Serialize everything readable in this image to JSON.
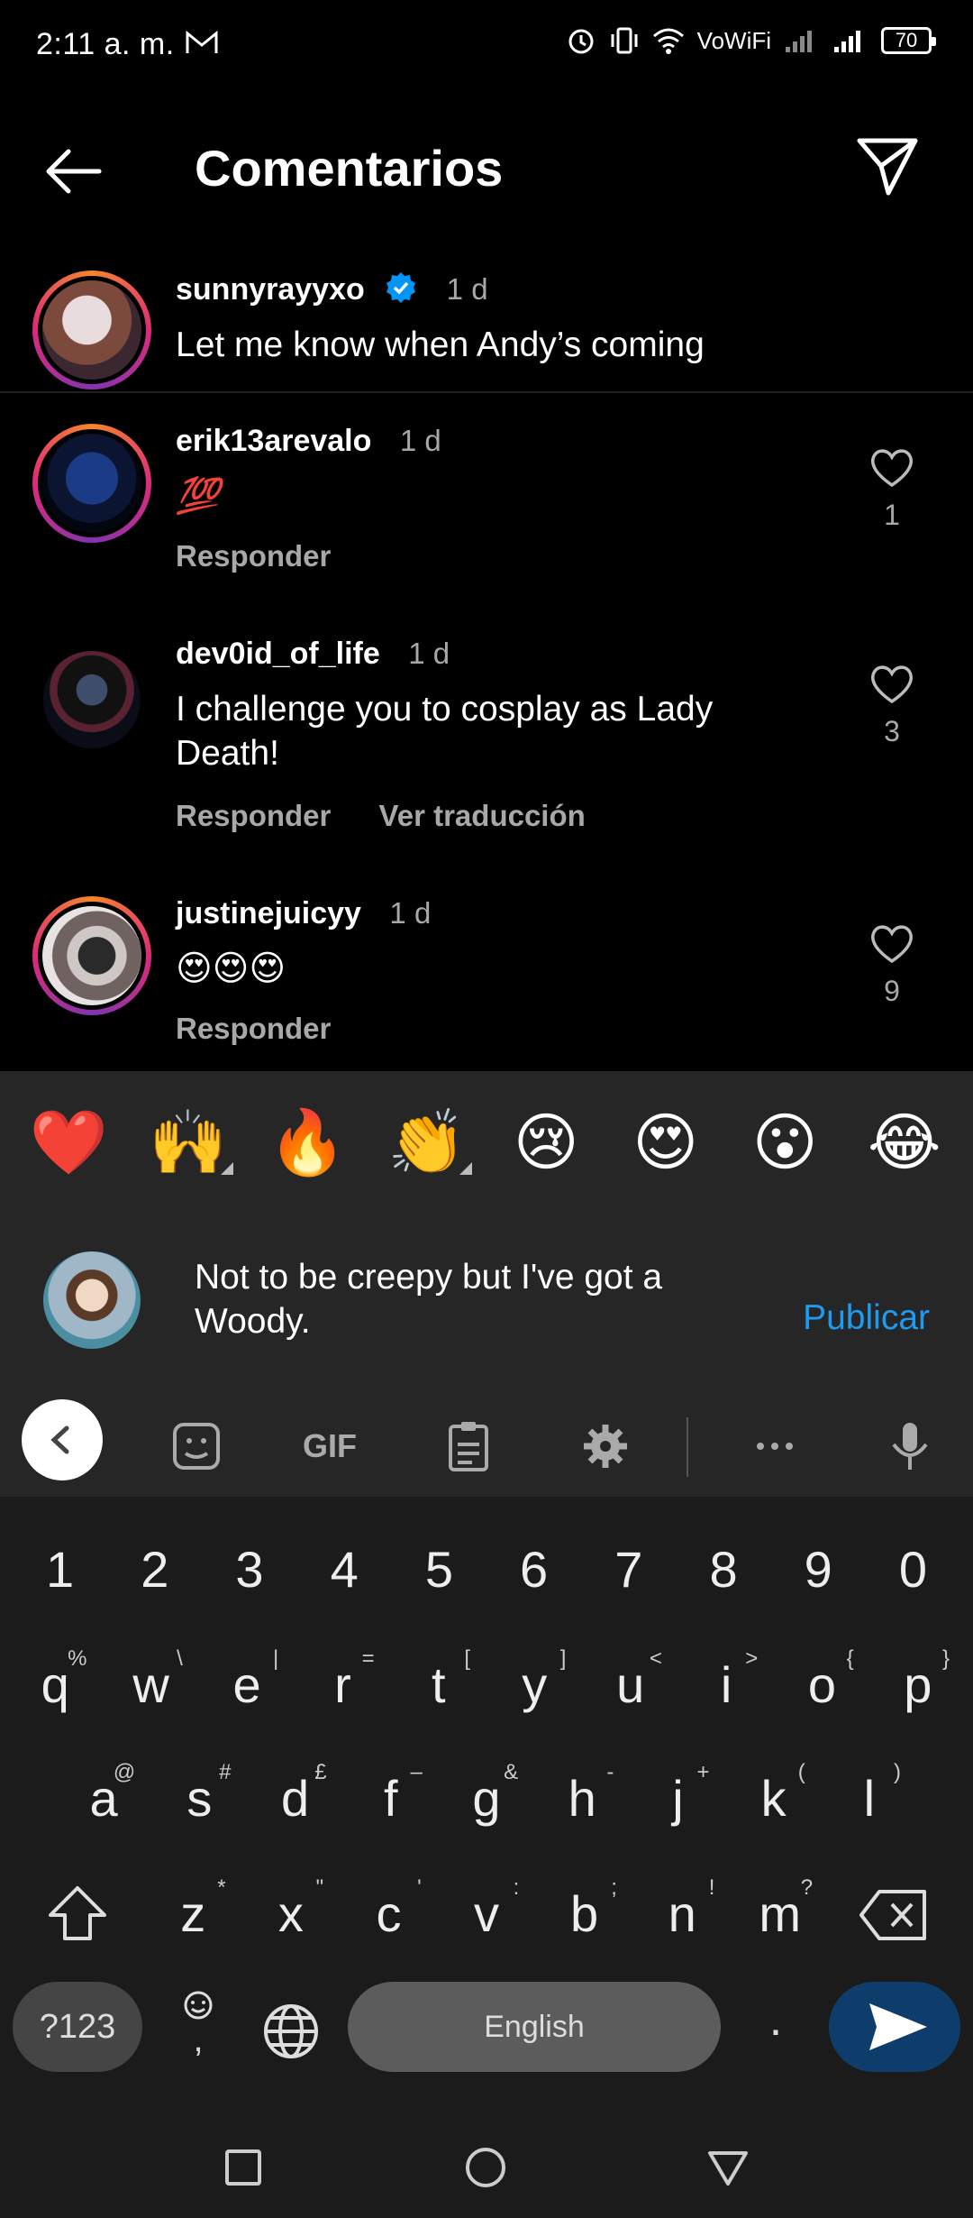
{
  "status": {
    "time": "2:11 a. m.",
    "network": "VoWiFi",
    "battery": "70"
  },
  "header": {
    "title": "Comentarios"
  },
  "comments": [
    {
      "username": "sunnyrayyxo",
      "time": "1 d",
      "verified": true,
      "text": "Let me know when Andy’s coming"
    },
    {
      "username": "erik13arevalo",
      "time": "1 d",
      "text": "💯",
      "reply": "Responder",
      "likes": "1"
    },
    {
      "username": "dev0id_of_life",
      "time": "1 d",
      "text": "I challenge you to cosplay as Lady Death!",
      "reply": "Responder",
      "translate": "Ver traducción",
      "likes": "3"
    },
    {
      "username": "justinejuicyy",
      "time": "1 d",
      "text": "😍😍😍",
      "reply": "Responder",
      "likes": "9"
    }
  ],
  "emoji_bar": [
    "❤️",
    "🙌",
    "🔥",
    "👏",
    "😢",
    "😍",
    "😮",
    "😂"
  ],
  "composer": {
    "text": "Not to be creepy but I've got a Woody.",
    "publish": "Publicar"
  },
  "keyboard": {
    "toolbar_gif": "GIF",
    "numbers": [
      "1",
      "2",
      "3",
      "4",
      "5",
      "6",
      "7",
      "8",
      "9",
      "0"
    ],
    "row1": [
      [
        "q",
        "%"
      ],
      [
        "w",
        "\\"
      ],
      [
        "e",
        "|"
      ],
      [
        "r",
        "="
      ],
      [
        "t",
        "["
      ],
      [
        "y",
        "]"
      ],
      [
        "u",
        "<"
      ],
      [
        "i",
        ">"
      ],
      [
        "o",
        "{"
      ],
      [
        "p",
        "}"
      ]
    ],
    "row2": [
      [
        "a",
        "@"
      ],
      [
        "s",
        "#"
      ],
      [
        "d",
        "£"
      ],
      [
        "f",
        "–"
      ],
      [
        "g",
        "&"
      ],
      [
        "h",
        "-"
      ],
      [
        "j",
        "+"
      ],
      [
        "k",
        "("
      ],
      [
        "l",
        ")"
      ]
    ],
    "row3": [
      [
        "z",
        "*"
      ],
      [
        "x",
        "\""
      ],
      [
        "c",
        "'"
      ],
      [
        "v",
        ":"
      ],
      [
        "b",
        ";"
      ],
      [
        "n",
        "!"
      ],
      [
        "m",
        "?"
      ]
    ],
    "symbols_key": "?123",
    "emoji_comma": ",",
    "space_label": "English",
    "period": "."
  }
}
